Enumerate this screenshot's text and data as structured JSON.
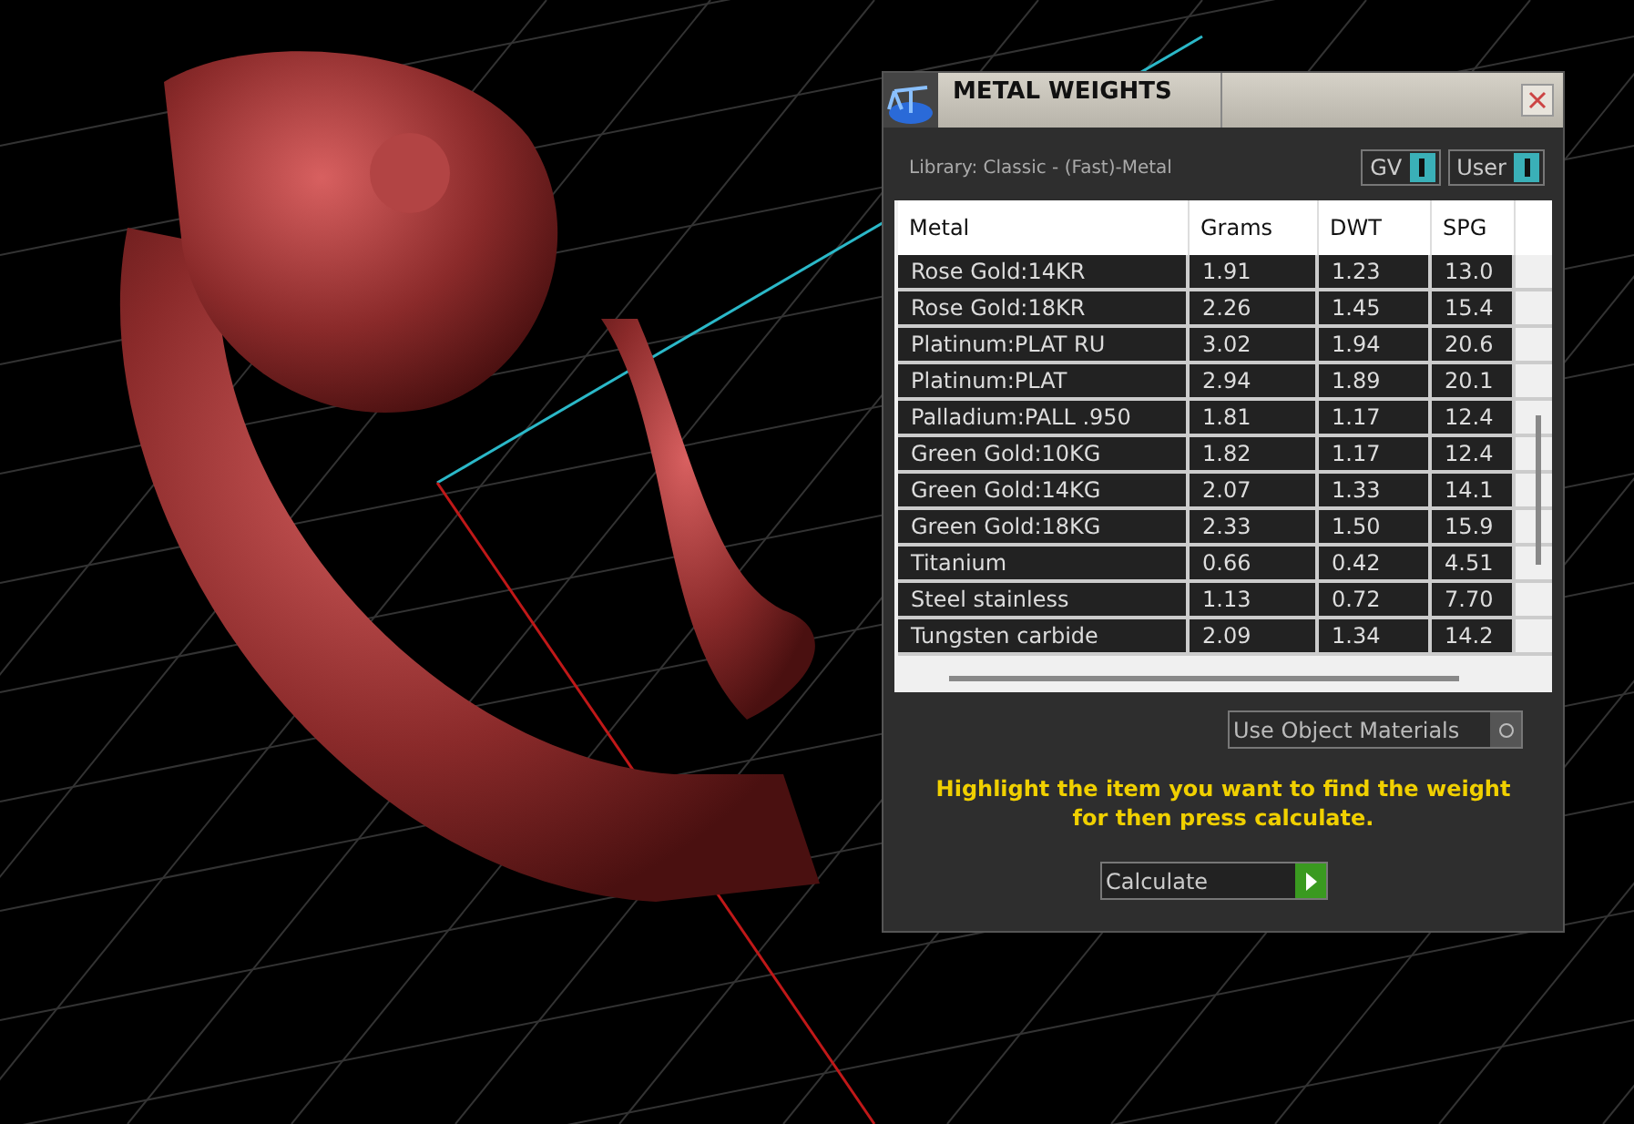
{
  "panel": {
    "title": "METAL WEIGHTS",
    "library": "Library: Classic - (Fast)-Metal",
    "toggles": [
      {
        "label": "GV",
        "on": true
      },
      {
        "label": "User",
        "on": true
      }
    ],
    "table": {
      "columns": [
        "Metal",
        "Grams",
        "DWT",
        "SPG"
      ],
      "rows": [
        [
          "Rose Gold:14KR",
          "1.91",
          "1.23",
          "13.0"
        ],
        [
          "Rose Gold:18KR",
          "2.26",
          "1.45",
          "15.4"
        ],
        [
          "Platinum:PLAT RU",
          "3.02",
          "1.94",
          "20.6"
        ],
        [
          "Platinum:PLAT",
          "2.94",
          "1.89",
          "20.1"
        ],
        [
          "Palladium:PALL .950",
          "1.81",
          "1.17",
          "12.4"
        ],
        [
          "Green Gold:10KG",
          "1.82",
          "1.17",
          "12.4"
        ],
        [
          "Green Gold:14KG",
          "2.07",
          "1.33",
          "14.1"
        ],
        [
          "Green Gold:18KG",
          "2.33",
          "1.50",
          "15.9"
        ],
        [
          "Titanium",
          "0.66",
          "0.42",
          "4.51"
        ],
        [
          "Steel stainless",
          "1.13",
          "0.72",
          "7.70"
        ],
        [
          "Tungsten carbide",
          "2.09",
          "1.34",
          "14.2"
        ]
      ]
    },
    "object_materials": {
      "label": "Use Object Materials",
      "on": false
    },
    "hint": "Highlight the item you want to find the weight for then press calculate.",
    "calculate_button": "Calculate"
  }
}
